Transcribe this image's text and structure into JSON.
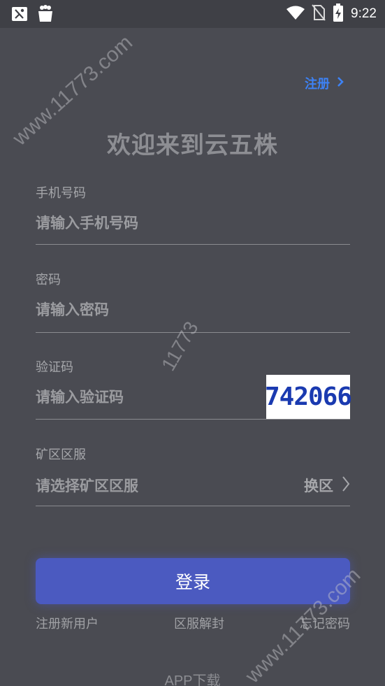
{
  "status_bar": {
    "time": "9:22",
    "icons": [
      "scissors-notification-icon",
      "gift-bag-notification-icon",
      "wifi-icon",
      "no-sim-icon",
      "battery-charging-icon"
    ]
  },
  "header": {
    "register_label": "注册",
    "title": "欢迎来到云五株"
  },
  "form": {
    "phone": {
      "label": "手机号码",
      "placeholder": "请输入手机号码",
      "value": ""
    },
    "password": {
      "label": "密码",
      "placeholder": "请输入密码",
      "value": ""
    },
    "captcha": {
      "label": "验证码",
      "placeholder": "请输入验证码",
      "value": "",
      "image_text": "742066"
    },
    "zone": {
      "label": "矿区区服",
      "placeholder": "请选择矿区区服",
      "switch_label": "换区"
    }
  },
  "actions": {
    "login_label": "登录",
    "register_new_user": "注册新用户",
    "zone_unblock": "区服解封",
    "forgot_password": "忘记密码",
    "app_download": "APP下载"
  },
  "watermarks": [
    "www.11773.com",
    "11773",
    "www.11773.com"
  ],
  "colors": {
    "background": "#4a4b52",
    "accent_link": "#3d82f5",
    "primary_button": "#4b5ac0",
    "captcha_text": "#1a3ab0"
  }
}
